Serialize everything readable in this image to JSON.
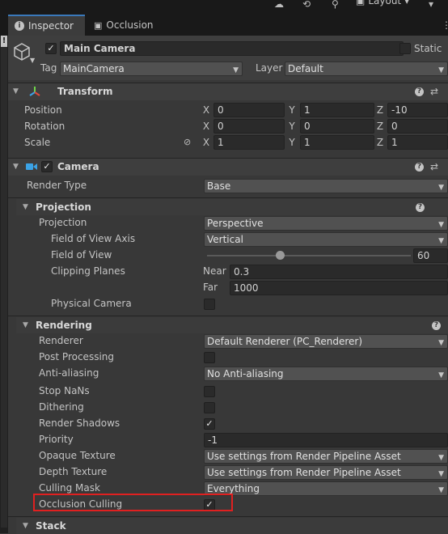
{
  "inspector": {
    "tabs": [
      {
        "label": "Inspector",
        "icon": "info-icon"
      },
      {
        "label": "Occlusion",
        "icon": "occlusion-icon"
      }
    ],
    "toolbar": {
      "layout_label": "Layout"
    },
    "object": {
      "name": "Main Camera",
      "static_label": "Static",
      "tag_label": "Tag",
      "tag_value": "MainCamera",
      "layer_label": "Layer",
      "layer_value": "Default"
    },
    "transform": {
      "title": "Transform",
      "rows": [
        {
          "label": "Position",
          "x": "0",
          "y": "1",
          "z": "-10"
        },
        {
          "label": "Rotation",
          "x": "0",
          "y": "0",
          "z": "0"
        },
        {
          "label": "Scale",
          "x": "1",
          "y": "1",
          "z": "1"
        }
      ]
    },
    "camera": {
      "title": "Camera",
      "render_type_label": "Render Type",
      "render_type_value": "Base",
      "projection_section": "Projection",
      "projection_label": "Projection",
      "projection_value": "Perspective",
      "fov_axis_label": "Field of View Axis",
      "fov_axis_value": "Vertical",
      "fov_label": "Field of View",
      "fov_value": "60",
      "fov_slider_fraction": 0.36,
      "clipping_label": "Clipping Planes",
      "near_label": "Near",
      "near_value": "0.3",
      "far_label": "Far",
      "far_value": "1000",
      "physical_camera_label": "Physical Camera",
      "rendering_section": "Rendering",
      "renderer_label": "Renderer",
      "renderer_value": "Default Renderer (PC_Renderer)",
      "post_processing_label": "Post Processing",
      "anti_aliasing_label": "Anti-aliasing",
      "anti_aliasing_value": "No Anti-aliasing",
      "stop_nans_label": "Stop NaNs",
      "dithering_label": "Dithering",
      "render_shadows_label": "Render Shadows",
      "priority_label": "Priority",
      "priority_value": "-1",
      "opaque_texture_label": "Opaque Texture",
      "opaque_texture_value": "Use settings from Render Pipeline Asset",
      "depth_texture_label": "Depth Texture",
      "depth_texture_value": "Use settings from Render Pipeline Asset",
      "culling_mask_label": "Culling Mask",
      "culling_mask_value": "Everything",
      "occlusion_culling_label": "Occlusion Culling",
      "stack_section": "Stack"
    },
    "axes": {
      "x": "X",
      "y": "Y",
      "z": "Z"
    },
    "glyphs": {
      "check": "✓",
      "help": "?",
      "arrow_down": "▼",
      "arrow_right": "▶",
      "dd": "▼"
    },
    "colors": {
      "accent": "#3a79bb",
      "highlight": "#e02020",
      "transform_icon": "#e2a02a",
      "camera_icon": "#3ba3e6"
    }
  }
}
